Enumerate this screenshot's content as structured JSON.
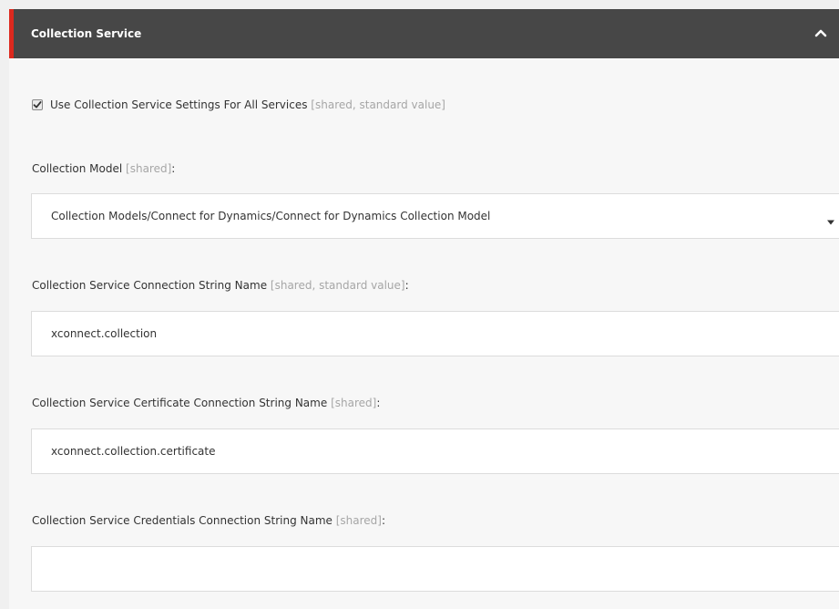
{
  "section": {
    "title": "Collection Service"
  },
  "use_settings": {
    "label": "Use Collection Service Settings For All Services",
    "meta": "[shared, standard value]",
    "checked": true
  },
  "fields": {
    "collection_model": {
      "label": "Collection Model",
      "meta": "[shared]",
      "colon": ":",
      "value": "Collection Models/Connect for Dynamics/Connect for Dynamics Collection Model"
    },
    "connection_string": {
      "label": "Collection Service Connection String Name",
      "meta": "[shared, standard value]",
      "colon": ":",
      "value": "xconnect.collection"
    },
    "certificate_string": {
      "label": "Collection Service Certificate Connection String Name",
      "meta": "[shared]",
      "colon": ":",
      "value": "xconnect.collection.certificate"
    },
    "credentials_string": {
      "label": "Collection Service Credentials Connection String Name",
      "meta": "[shared]",
      "colon": ":",
      "value": ""
    }
  },
  "icons": {
    "collapse": "chevron-up-icon",
    "dropdown": "caret-down-icon",
    "check": "checkmark-icon"
  },
  "colors": {
    "header_bg": "#474747",
    "accent": "#dc291e",
    "meta_text": "#a6a6a6"
  }
}
